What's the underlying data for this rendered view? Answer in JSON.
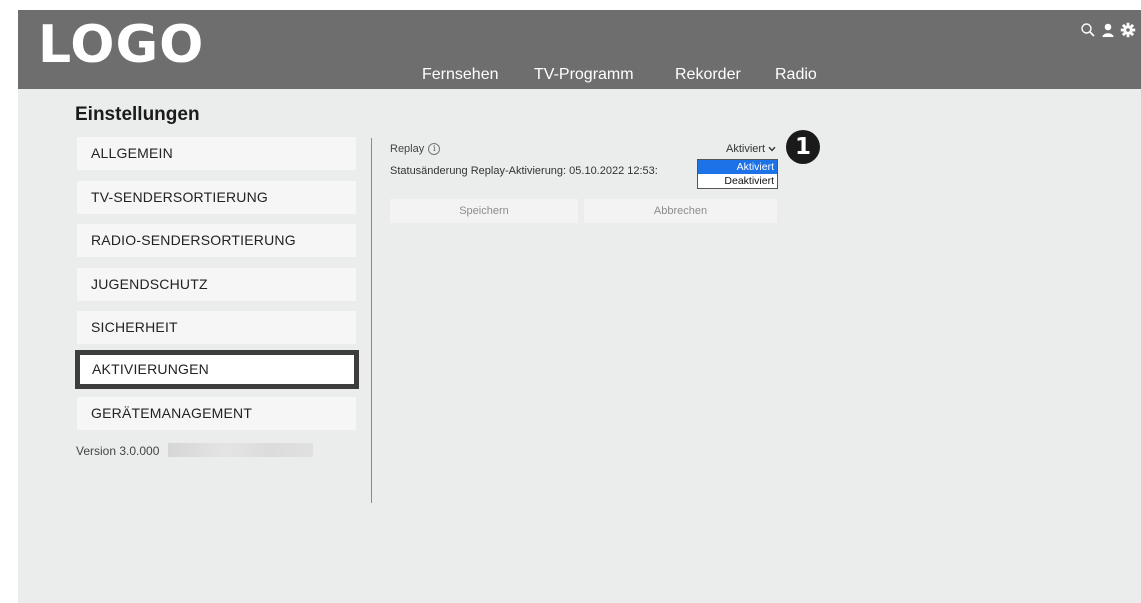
{
  "header": {
    "logo": "LOGO",
    "nav": [
      "Fernsehen",
      "TV-Programm",
      "Rekorder",
      "Radio"
    ],
    "icons": [
      "search-icon",
      "user-icon",
      "gear-icon"
    ]
  },
  "page": {
    "title": "Einstellungen"
  },
  "sidebar": {
    "items": [
      {
        "label": "ALLGEMEIN",
        "active": false
      },
      {
        "label": "TV-SENDERSORTIERUNG",
        "active": false
      },
      {
        "label": "RADIO-SENDERSORTIERUNG",
        "active": false
      },
      {
        "label": "JUGENDSCHUTZ",
        "active": false
      },
      {
        "label": "SICHERHEIT",
        "active": false
      },
      {
        "label": "AKTIVIERUNGEN",
        "active": true
      },
      {
        "label": "GERÄTEMANAGEMENT",
        "active": false
      }
    ],
    "version": "Version 3.0.000"
  },
  "main": {
    "replay_label": "Replay",
    "info_icon": "i",
    "status_text": "Statusänderung Replay-Aktivierung: 05.10.2022 12:53:",
    "select": {
      "value": "Aktiviert",
      "options": [
        "Aktiviert",
        "Deaktiviert"
      ],
      "highlighted": "Aktiviert",
      "highlight_color": "#1e72e8"
    },
    "marker": "1",
    "buttons": {
      "save": "Speichern",
      "cancel": "Abbrechen"
    }
  },
  "colors": {
    "header_bg": "#6e6e6e",
    "page_bg": "#ebeded",
    "active_border": "#3d3d3d"
  }
}
